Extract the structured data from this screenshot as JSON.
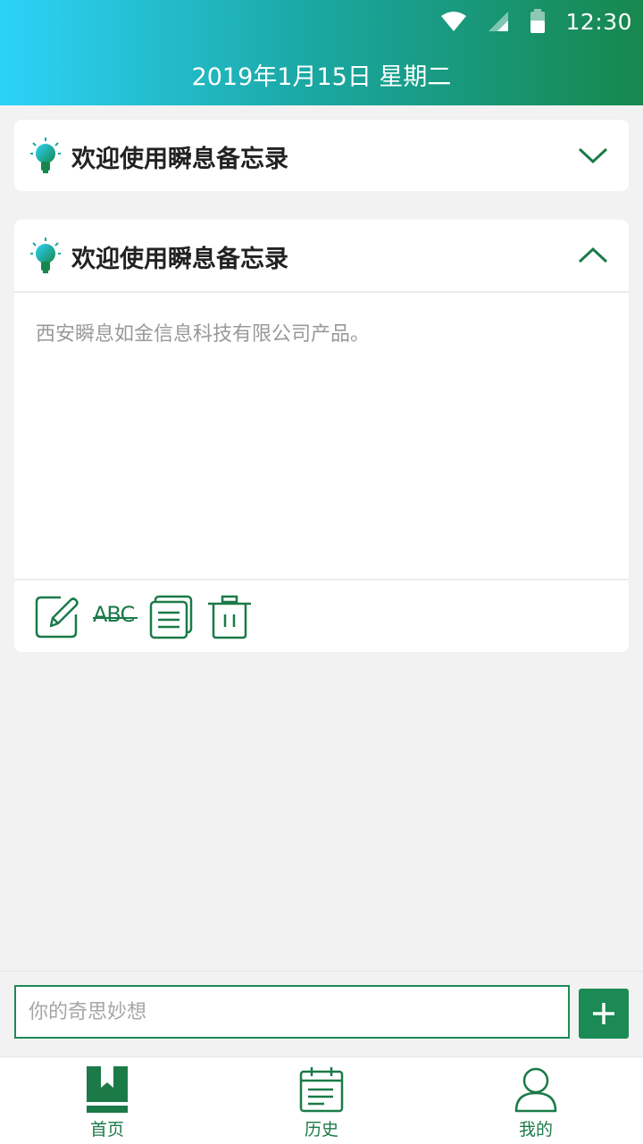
{
  "status_bar": {
    "time": "12:30",
    "icons": [
      "wifi-icon",
      "signal-icon",
      "battery-icon"
    ]
  },
  "header": {
    "date": "2019年1月15日 星期二"
  },
  "memos": [
    {
      "title": "欢迎使用瞬息备忘录",
      "expanded": false
    },
    {
      "title": "欢迎使用瞬息备忘录",
      "expanded": true,
      "content": "西安瞬息如金信息科技有限公司产品。",
      "actions": [
        "edit-icon",
        "strikethrough-icon",
        "copy-icon",
        "trash-icon"
      ],
      "strike_label": "ABC"
    }
  ],
  "input": {
    "placeholder": "你的奇思妙想"
  },
  "tabs": [
    {
      "label": "首页",
      "icon": "bookmark-icon",
      "active": true
    },
    {
      "label": "历史",
      "icon": "calendar-icon",
      "active": false
    },
    {
      "label": "我的",
      "icon": "user-icon",
      "active": false
    }
  ],
  "colors": {
    "primary": "#1b8a55",
    "header_start": "#2dd2f8",
    "header_end": "#17874d",
    "background": "#f2f2f2"
  }
}
